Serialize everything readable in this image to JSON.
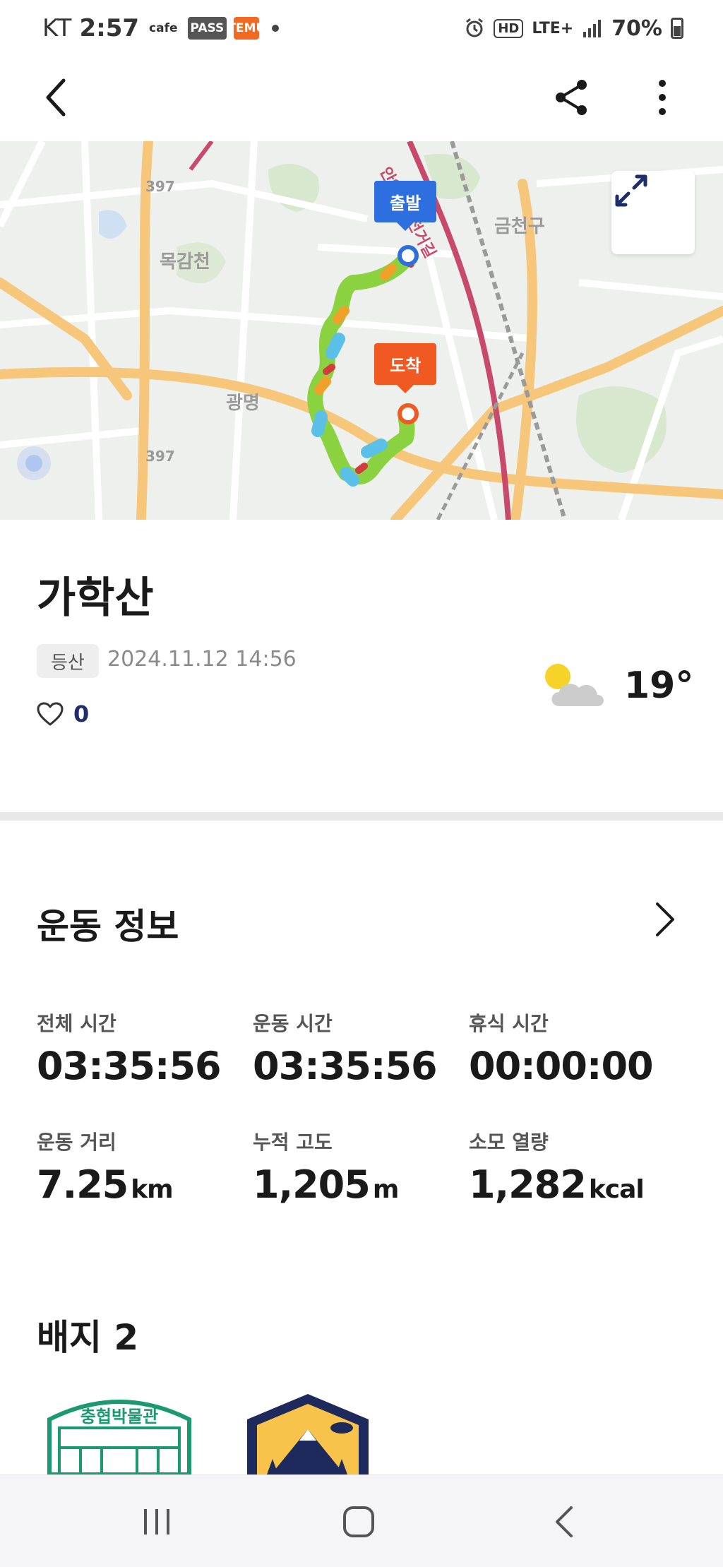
{
  "status_bar": {
    "carrier": "KT",
    "time": "2:57",
    "app_badges": [
      "cafe",
      "PASS",
      "TEMU"
    ],
    "network": "LTE+",
    "hd": "HD",
    "battery": "70%"
  },
  "app_bar": {
    "icons": [
      "back-icon",
      "share-icon",
      "more-icon"
    ]
  },
  "map": {
    "place_labels": [
      "금천구",
      "목감천",
      "광명"
    ],
    "road_numbers": [
      "397",
      "397"
    ],
    "road_name": "안양천자전거길",
    "start_label": "출발",
    "end_label": "도착",
    "route_color": "#8bd240",
    "start_color": "#2e6fe0",
    "end_color": "#f05a22"
  },
  "record": {
    "title": "가학산",
    "category": "등산",
    "date": "2024.11.12 14:56",
    "likes": "0",
    "temperature": "19°",
    "weather_icon": "partly-cloudy-icon"
  },
  "exercise": {
    "title": "운동 정보",
    "stats": [
      {
        "label": "전체 시간",
        "value": "03:35:56",
        "unit": ""
      },
      {
        "label": "운동 시간",
        "value": "03:35:56",
        "unit": ""
      },
      {
        "label": "휴식 시간",
        "value": "00:00:00",
        "unit": ""
      },
      {
        "label": "운동 거리",
        "value": "7.25",
        "unit": "km"
      },
      {
        "label": "누적 고도",
        "value": "1,205",
        "unit": "m"
      },
      {
        "label": "소모 열량",
        "value": "1,282",
        "unit": "kcal"
      }
    ]
  },
  "badges": {
    "title": "배지 2",
    "items": [
      {
        "name": "충협박물관",
        "color": "#1a9a6e"
      },
      {
        "name": "mountain-badge",
        "color": "#1d2a5b"
      }
    ]
  },
  "nav": {
    "icons": [
      "recents-icon",
      "home-icon",
      "back-icon"
    ]
  }
}
